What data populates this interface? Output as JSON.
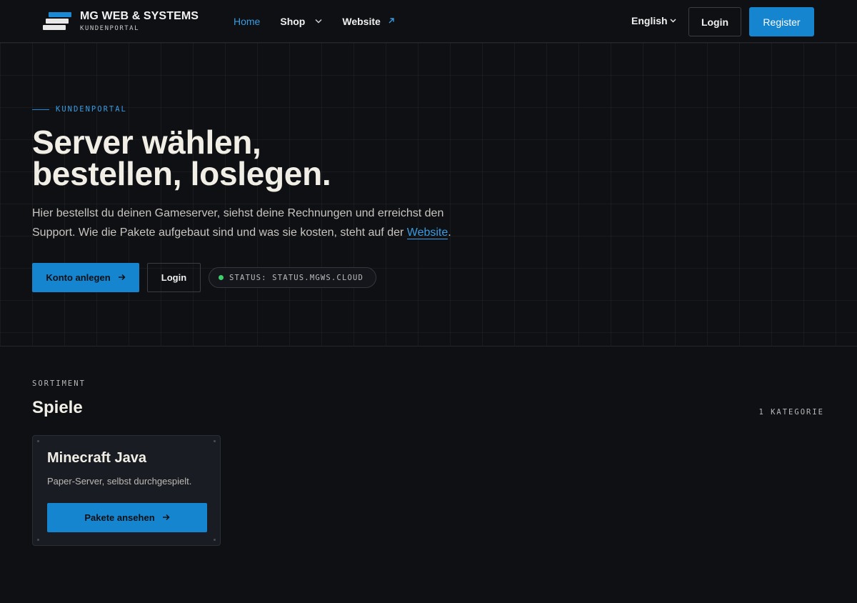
{
  "header": {
    "brand_title": "MG WEB & SYSTEMS",
    "brand_subtitle": "KUNDENPORTAL",
    "nav": [
      {
        "label": "Home"
      },
      {
        "label": "Shop"
      },
      {
        "label": "Website"
      }
    ],
    "language": "English",
    "login_label": "Login",
    "register_label": "Register"
  },
  "hero": {
    "eyebrow": "KUNDENPORTAL",
    "title_line1": "Server wählen,",
    "title_line2": "bestellen, loslegen.",
    "text_before_link": "Hier bestellst du deinen Gameserver, siehst deine Rechnungen und erreichst den Support. Wie die Pakete aufgebaut sind und was sie kosten, steht auf der ",
    "text_link": "Website",
    "text_after_link": ".",
    "primary_button": "Konto anlegen",
    "secondary_button": "Login",
    "status_label": "STATUS: STATUS.MGWS.CLOUD"
  },
  "catalog": {
    "section_label": "SORTIMENT",
    "section_title": "Spiele",
    "category_count": "1 KATEGORIE",
    "cards": [
      {
        "title": "Minecraft Java",
        "description": "Paper-Server, selbst durchgespielt.",
        "button_label": "Pakete ansehen"
      }
    ]
  },
  "colors": {
    "accent": "#1585d0",
    "link": "#3a9be0",
    "background": "#0e1014",
    "status_ok": "#3ecf6b"
  },
  "icons": {
    "shop_dropdown": "chevron-down-icon",
    "website_external": "external-link-icon",
    "arrow": "arrow-right-icon"
  }
}
